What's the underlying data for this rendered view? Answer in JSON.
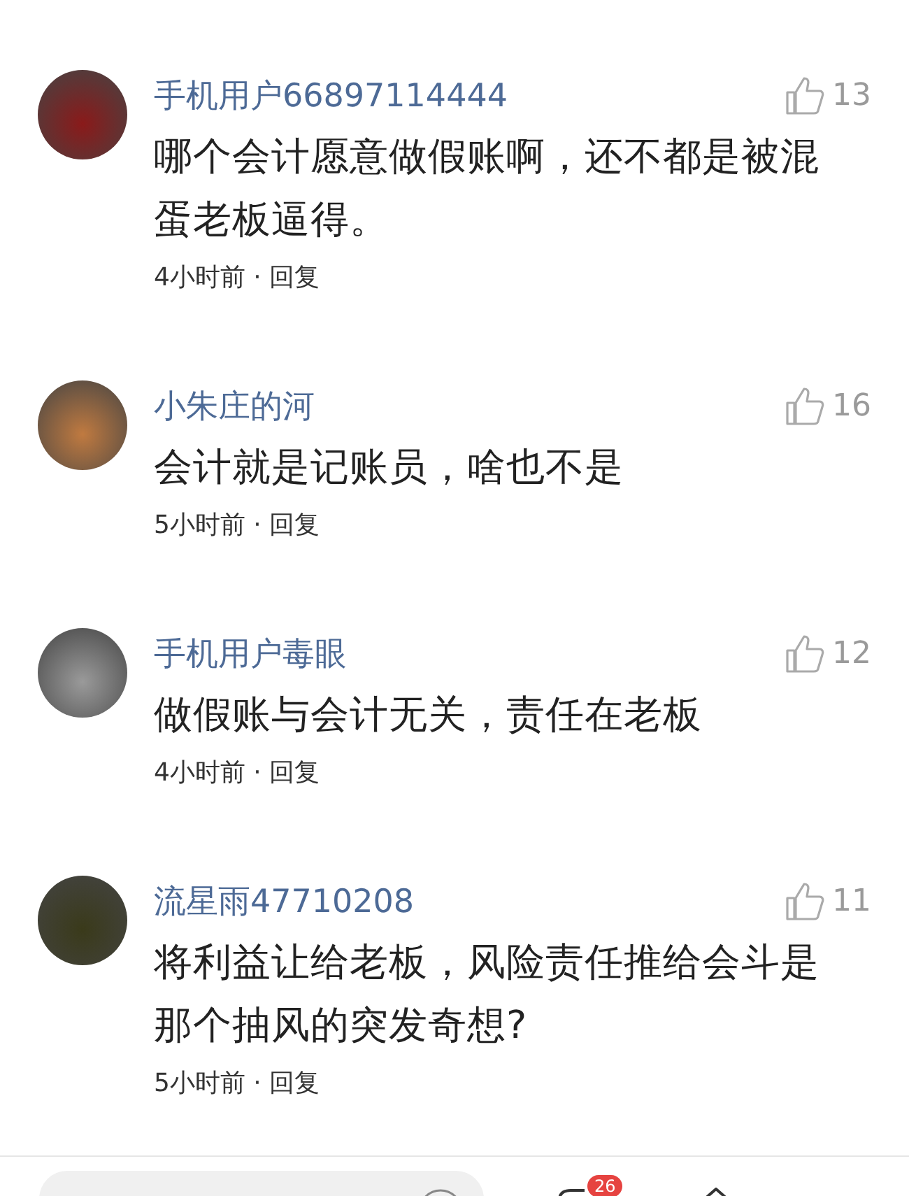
{
  "comments": [
    {
      "user": "手机用户66897114444",
      "likes": "13",
      "text": "哪个会计愿意做假账啊，还不都是被混蛋老板逼得。",
      "time": "4小时前 ·",
      "reply": "回复"
    },
    {
      "user": "小朱庄的河",
      "likes": "16",
      "text": "会计就是记账员，啥也不是",
      "time": "5小时前 ·",
      "reply": "回复"
    },
    {
      "user": "手机用户毒眼",
      "likes": "12",
      "text": "做假账与会计无关，责任在老板",
      "time": "4小时前 ·",
      "reply": "回复"
    },
    {
      "user": "流星雨47710208",
      "likes": "11",
      "text": "将利益让给老板，风险责任推给会斗是那个抽风的突发奇想?",
      "time": "5小时前 ·",
      "reply": "回复"
    }
  ],
  "bottom_bar": {
    "comment_badge": "26"
  }
}
